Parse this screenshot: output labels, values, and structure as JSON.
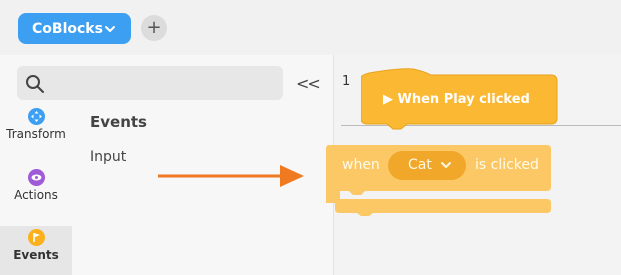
{
  "topbar": {
    "project_label": "CoBlocks",
    "add_symbol": "+"
  },
  "sidebar": {
    "collapse_symbol": "<<",
    "categories": [
      {
        "label": "Transform",
        "color": "#3d9ff2",
        "icon": "move-arrows-icon"
      },
      {
        "label": "Actions",
        "color": "#a05bd8",
        "icon": "eye-icon"
      },
      {
        "label": "Events",
        "color": "#fbb01c",
        "icon": "flag-icon",
        "selected": true
      }
    ],
    "palette": {
      "title": "Events",
      "items": [
        "Input"
      ]
    }
  },
  "workspace": {
    "line_number": "1",
    "hat_block_label": "▶ When Play clicked",
    "dragged_block": {
      "prefix": "when",
      "dropdown_value": "Cat",
      "suffix": "is clicked"
    }
  },
  "colors": {
    "accent_blue": "#3d9ff2",
    "event_yellow": "#fbb833",
    "arrow_orange": "#f07a1f"
  }
}
